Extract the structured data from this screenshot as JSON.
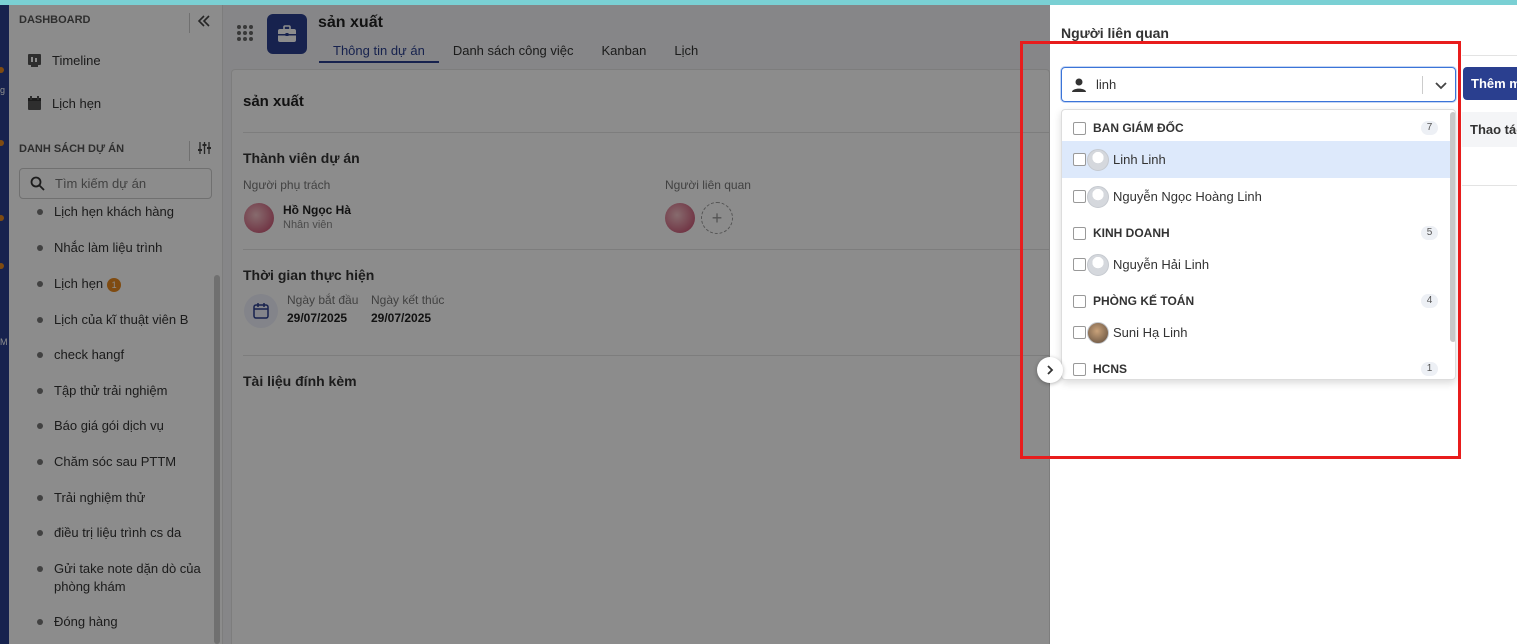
{
  "rail": {
    "fragments": [
      "g",
      "M"
    ]
  },
  "sidebar": {
    "dashboard_label": "DASHBOARD",
    "nav": [
      {
        "label": "Timeline",
        "icon": "timeline-icon"
      },
      {
        "label": "Lịch hẹn",
        "icon": "calendar-icon"
      }
    ],
    "projects_label": "DANH SÁCH DỰ ÁN",
    "search_placeholder": "Tìm kiếm dự án",
    "projects": [
      {
        "label": "Lịch hẹn khách hàng"
      },
      {
        "label": "Nhắc làm liệu trình"
      },
      {
        "label": "Lịch hẹn",
        "badge": "1"
      },
      {
        "label": "Lịch của kĩ thuật viên B"
      },
      {
        "label": "check hangf"
      },
      {
        "label": "Tập thử trải nghiệm"
      },
      {
        "label": "Báo giá gói dịch vụ"
      },
      {
        "label": "Chăm sóc sau PTTM"
      },
      {
        "label": "Trải nghiệm thử"
      },
      {
        "label": "điều trị liệu trình cs da"
      },
      {
        "label": "Gửi take note dặn dò của phòng khám"
      },
      {
        "label": "Đóng hàng"
      }
    ]
  },
  "header": {
    "title": "sản xuất",
    "tabs": [
      {
        "label": "Thông tin dự án",
        "active": true
      },
      {
        "label": "Danh sách công việc"
      },
      {
        "label": "Kanban"
      },
      {
        "label": "Lịch"
      }
    ]
  },
  "project": {
    "title": "sản xuất",
    "members_title": "Thành viên dự án",
    "owner_label": "Người phụ trách",
    "owner_name": "Hồ Ngọc Hà",
    "owner_role": "Nhân viên",
    "related_label": "Người liên quan",
    "add_symbol": "+",
    "time_title": "Thời gian thực hiện",
    "start_label": "Ngày bắt đầu",
    "start_date": "29/07/2025",
    "end_label": "Ngày kết thúc",
    "end_date": "29/07/2025",
    "attachments_title": "Tài liệu đính kèm"
  },
  "drawer": {
    "title": "Người liên quan",
    "search_value": "linh",
    "add_button": "Thêm m",
    "column_header": "Thao tác",
    "groups": [
      {
        "name": "BAN GIÁM ĐỐC",
        "count": "7",
        "members": [
          {
            "name": "Linh Linh",
            "highlighted": true
          },
          {
            "name": "Nguyễn Ngọc Hoàng Linh"
          }
        ]
      },
      {
        "name": "KINH DOANH",
        "count": "5",
        "members": [
          {
            "name": "Nguyễn Hải Linh"
          }
        ]
      },
      {
        "name": "PHÒNG KẾ TOÁN",
        "count": "4",
        "members": [
          {
            "name": "Suni Hạ Linh",
            "photo": true
          }
        ]
      },
      {
        "name": "HCNS",
        "count": "1",
        "members": []
      }
    ]
  },
  "colors": {
    "brand": "#2a3f8f",
    "accent": "#e8891f",
    "highlight_frame": "#e81c1c",
    "focus": "#3b74d8"
  }
}
